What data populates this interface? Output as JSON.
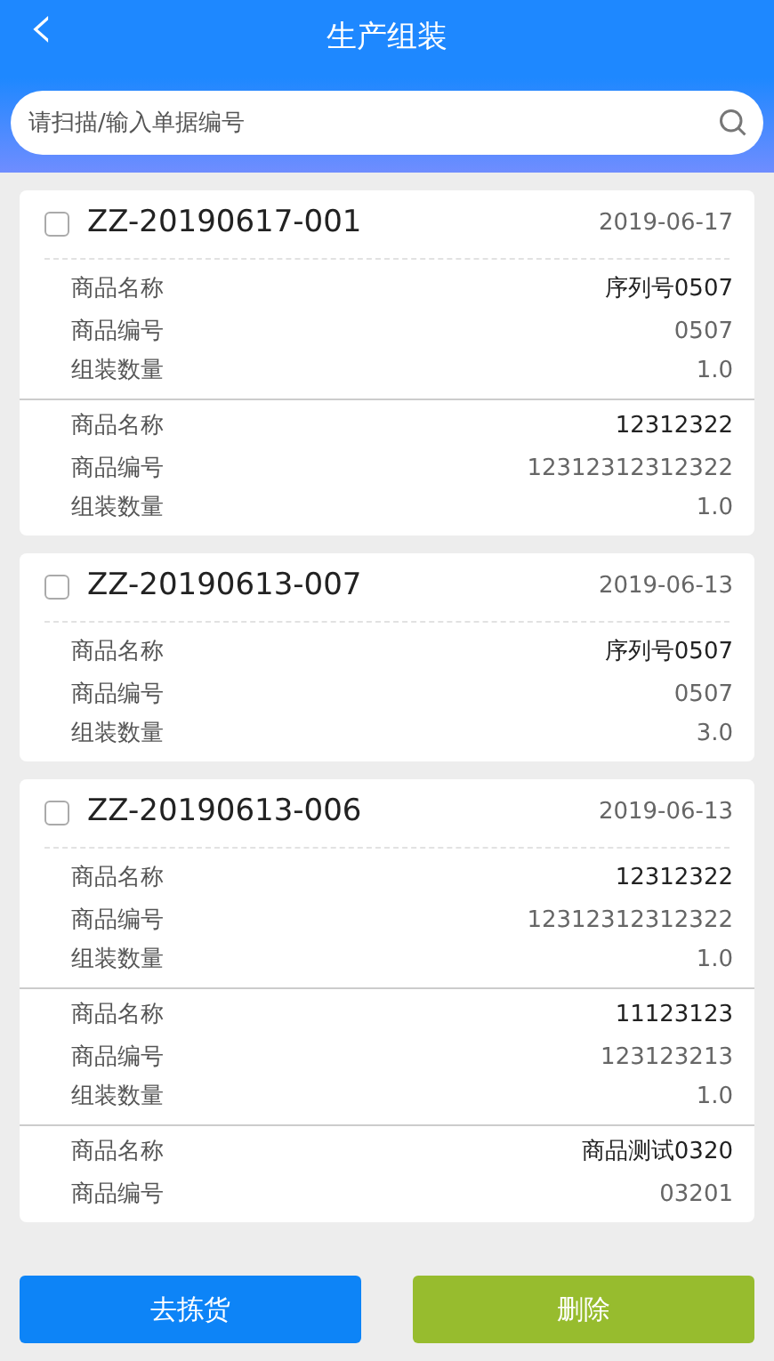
{
  "header": {
    "back": "‹",
    "title": "生产组装"
  },
  "search": {
    "placeholder": "请扫描/输入单据编号"
  },
  "orders": [
    {
      "number": "ZZ-20190617-001",
      "date": "2019-06-17",
      "checked": false,
      "items": [
        {
          "fields": [
            {
              "kind": "name",
              "label": "商品名称",
              "value": "序列号0507"
            },
            {
              "kind": "plain",
              "label": "商品编号",
              "value": "0507"
            },
            {
              "kind": "plain",
              "label": "组装数量",
              "value": "1.0"
            }
          ]
        },
        {
          "fields": [
            {
              "kind": "name",
              "label": "商品名称",
              "value": "12312322"
            },
            {
              "kind": "plain",
              "label": "商品编号",
              "value": "12312312312322"
            },
            {
              "kind": "plain",
              "label": "组装数量",
              "value": "1.0"
            }
          ]
        }
      ]
    },
    {
      "number": "ZZ-20190613-007",
      "date": "2019-06-13",
      "checked": false,
      "items": [
        {
          "fields": [
            {
              "kind": "name",
              "label": "商品名称",
              "value": "序列号0507"
            },
            {
              "kind": "plain",
              "label": "商品编号",
              "value": "0507"
            },
            {
              "kind": "plain",
              "label": "组装数量",
              "value": "3.0"
            }
          ]
        }
      ]
    },
    {
      "number": "ZZ-20190613-006",
      "date": "2019-06-13",
      "checked": false,
      "items": [
        {
          "fields": [
            {
              "kind": "name",
              "label": "商品名称",
              "value": "12312322"
            },
            {
              "kind": "plain",
              "label": "商品编号",
              "value": "12312312312322"
            },
            {
              "kind": "plain",
              "label": "组装数量",
              "value": "1.0"
            }
          ]
        },
        {
          "fields": [
            {
              "kind": "name",
              "label": "商品名称",
              "value": "11123123"
            },
            {
              "kind": "plain",
              "label": "商品编号",
              "value": "123123213"
            },
            {
              "kind": "plain",
              "label": "组装数量",
              "value": "1.0"
            }
          ]
        },
        {
          "fields": [
            {
              "kind": "name",
              "label": "商品名称",
              "value": "商品测试0320"
            },
            {
              "kind": "plain",
              "label": "商品编号",
              "value": "03201"
            }
          ]
        }
      ]
    }
  ],
  "buttons": [
    {
      "kind": "primary",
      "label": "去拣货"
    },
    {
      "kind": "danger",
      "label": "删除"
    }
  ]
}
